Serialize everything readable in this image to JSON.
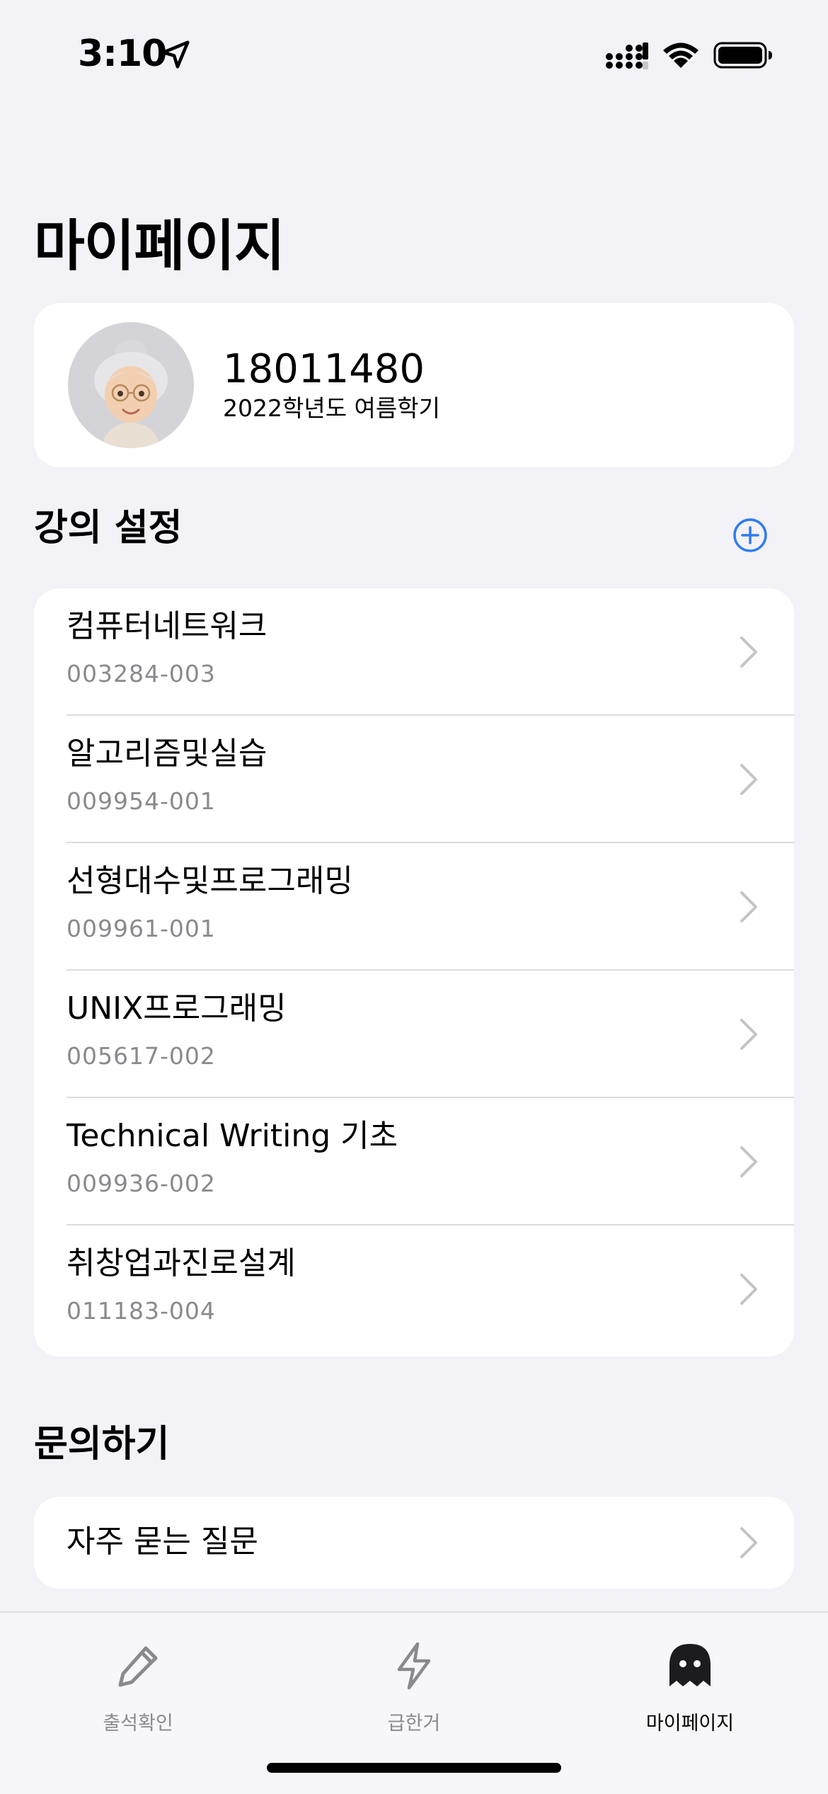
{
  "status_bar": {
    "time": "3:10"
  },
  "page": {
    "title": "마이페이지"
  },
  "profile": {
    "student_id": "18011480",
    "term": "2022학년도 여름학기",
    "avatar": "grandmother-memoji"
  },
  "lectures": {
    "section_title": "강의 설정",
    "add_icon": "plus-circle-icon",
    "items": [
      {
        "name": "컴퓨터네트워크",
        "code": "003284-003"
      },
      {
        "name": "알고리즘및실습",
        "code": "009954-001"
      },
      {
        "name": "선형대수및프로그래밍",
        "code": "009961-001"
      },
      {
        "name": "UNIX프로그래밍",
        "code": "005617-002"
      },
      {
        "name": "Technical Writing 기초",
        "code": "009936-002"
      },
      {
        "name": "취창업과진로설계",
        "code": "011183-004"
      }
    ]
  },
  "inquiry": {
    "section_title": "문의하기",
    "faq_label": "자주 묻는 질문"
  },
  "tab_bar": {
    "tabs": [
      {
        "label": "출석확인",
        "icon": "pencil-icon",
        "active": false
      },
      {
        "label": "급한거",
        "icon": "bolt-icon",
        "active": false
      },
      {
        "label": "마이페이지",
        "icon": "ghost-icon",
        "active": true
      }
    ]
  },
  "colors": {
    "background": "#f2f2f7",
    "card": "#ffffff",
    "accent": "#2f7bf0",
    "secondary_text": "#8a8a8e"
  }
}
